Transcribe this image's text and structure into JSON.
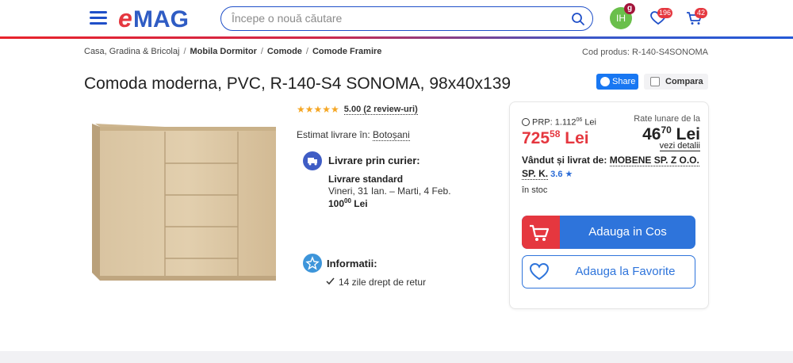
{
  "header": {
    "search_placeholder": "Începe o nouă căutare",
    "avatar_initials": "IH",
    "avatar_badge": "g",
    "favorites_count": "196",
    "cart_count": "42",
    "logo_text": "eMAG"
  },
  "breadcrumb": {
    "items": [
      "Casa, Gradina & Bricolaj",
      "Mobila Dormitor",
      "Comode",
      "Comode Framire"
    ]
  },
  "product_code": "Cod produs: R-140-S4SONOMA",
  "title": "Comoda moderna, PVC, R-140-S4 SONOMA, 98x40x139",
  "actions": {
    "share": "Share",
    "compare": "Compara"
  },
  "rating": {
    "stars": "★★★★★",
    "text": "5.00 (2 review-uri)"
  },
  "delivery": {
    "estimate_label": "Estimat livrare în:",
    "location": "Botoșani",
    "courier_title": "Livrare prin curier:",
    "standard_label": "Livrare standard",
    "dates": "Vineri, 31 Ian. – Marti, 4 Feb.",
    "price_int": "100",
    "price_dec": "00",
    "currency": "Lei"
  },
  "info": {
    "title": "Informatii:",
    "return": "14 zile drept de retur"
  },
  "pricing": {
    "prp_label": "PRP: 1.112",
    "prp_dec": "06",
    "prp_currency": "Lei",
    "price_int": "725",
    "price_dec": "58",
    "price_currency": "Lei",
    "rate_label": "Rate lunare de la",
    "rate_int": "46",
    "rate_dec": "70",
    "rate_currency": "Lei",
    "rate_link": "vezi detalii",
    "seller_label": "Vândut și livrat de:",
    "seller_name": "MOBENE SP. Z O.O. SP. K.",
    "seller_score": "3.6 ★",
    "stock": "în stoc",
    "add_to_cart": "Adauga in Cos",
    "add_to_favorites": "Adauga la Favorite"
  },
  "colors": {
    "brand_blue": "#2e74db",
    "brand_red": "#e5373f"
  }
}
